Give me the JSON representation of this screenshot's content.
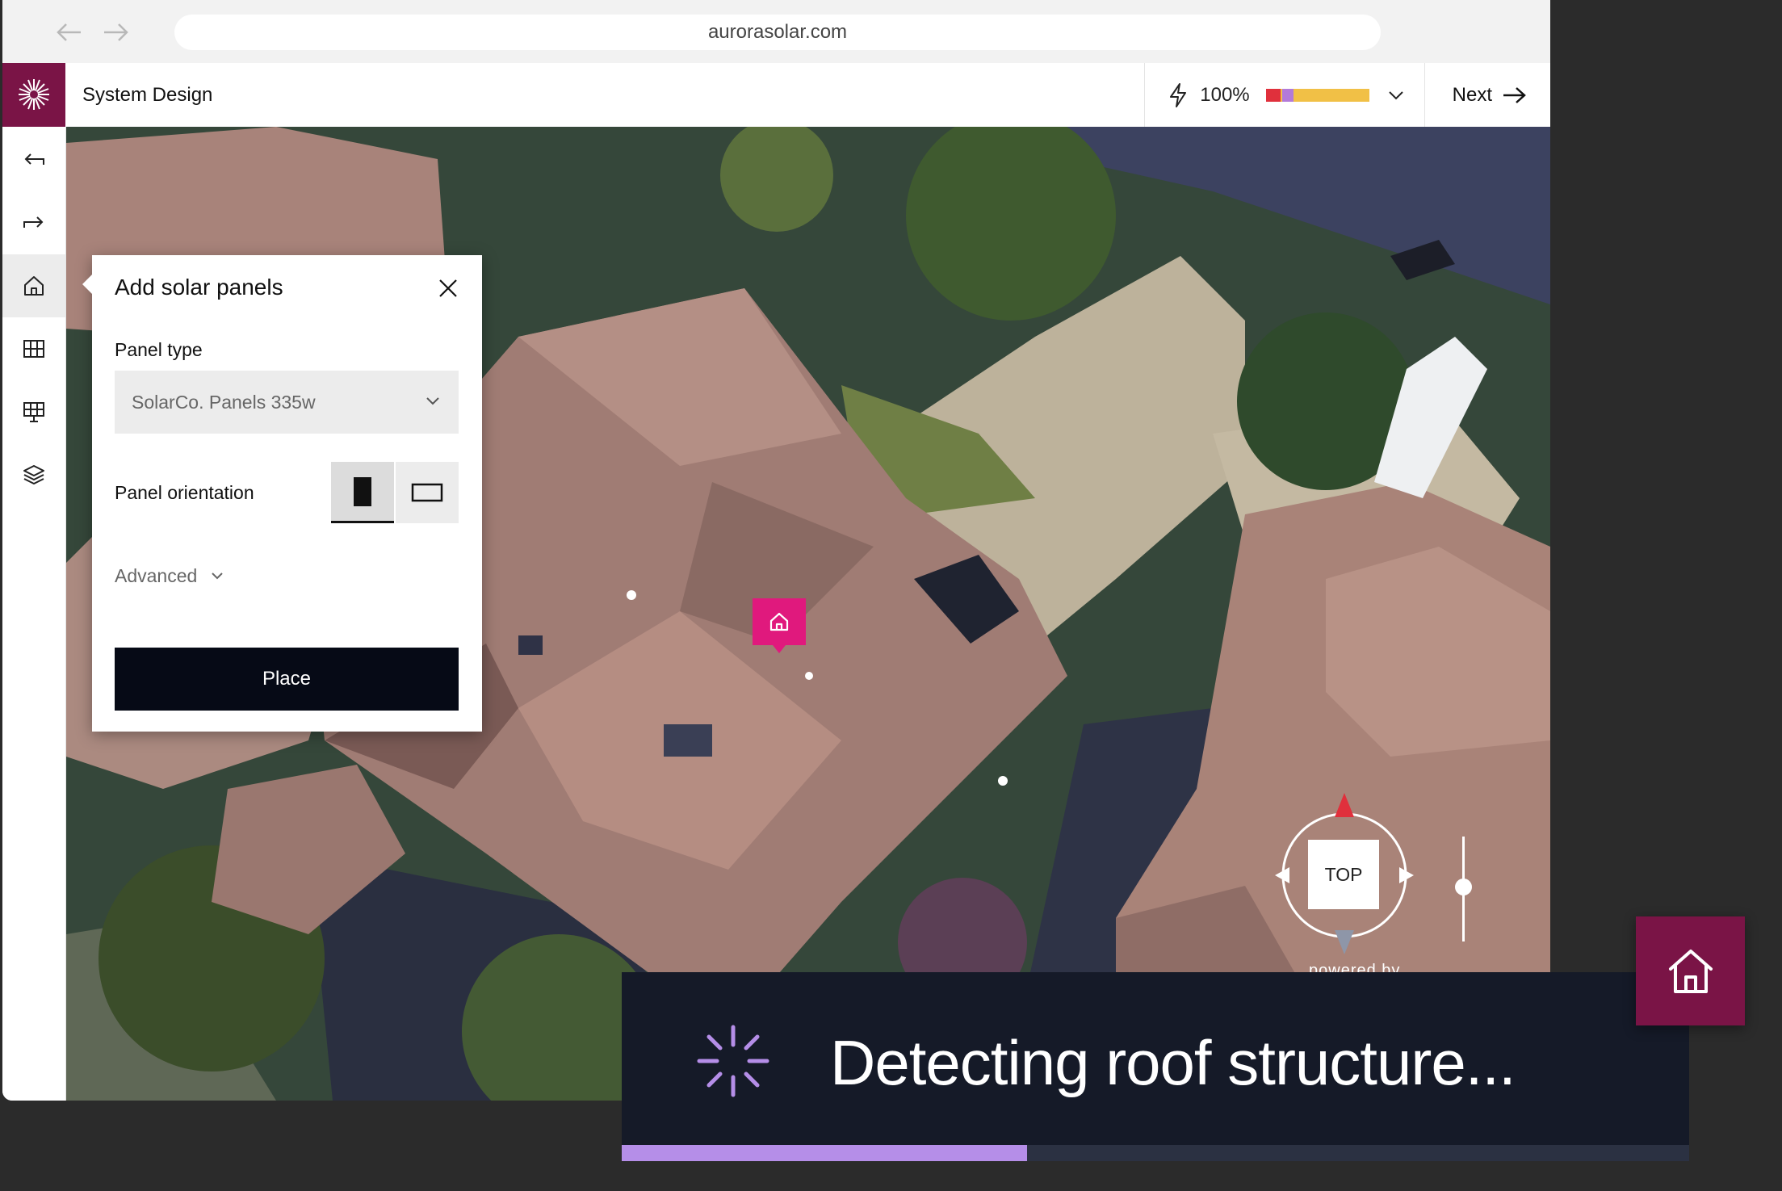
{
  "browser": {
    "url": "aurorasolar.com",
    "icons": [
      "back-arrow-icon",
      "forward-arrow-icon"
    ]
  },
  "header": {
    "title": "System Design",
    "power_percent": "100%",
    "meter_fill": 1.0,
    "next_label": "Next",
    "icons": [
      "aurora-logo-icon",
      "bolt-icon",
      "chevron-down-icon",
      "arrow-right-icon"
    ]
  },
  "sidebar": {
    "items": [
      {
        "icon": "undo-icon",
        "active": false
      },
      {
        "icon": "redo-icon",
        "active": false
      },
      {
        "icon": "home-icon",
        "active": true
      },
      {
        "icon": "grid-icon",
        "active": false
      },
      {
        "icon": "solar-panel-icon",
        "active": false
      },
      {
        "icon": "layers-icon",
        "active": false
      }
    ]
  },
  "panel": {
    "title": "Add solar panels",
    "panel_type_label": "Panel type",
    "panel_type_value": "SolarCo. Panels 335w",
    "orientation_label": "Panel orientation",
    "orientation_selected": "portrait",
    "advanced_label": "Advanced",
    "place_label": "Place"
  },
  "map": {
    "compass_label": "TOP",
    "attribution": "powered by",
    "marker_icon": "home-icon"
  },
  "overlay": {
    "status_text": "Detecting roof structure...",
    "progress": 0.38
  },
  "colors": {
    "brand": "#7a1446",
    "marker": "#e0197d",
    "progress": "#b58ee8",
    "overlay_bg": "#151a28",
    "meter_red": "#e0303c",
    "meter_purple": "#b37ad8",
    "meter_yellow": "#f1c046"
  }
}
